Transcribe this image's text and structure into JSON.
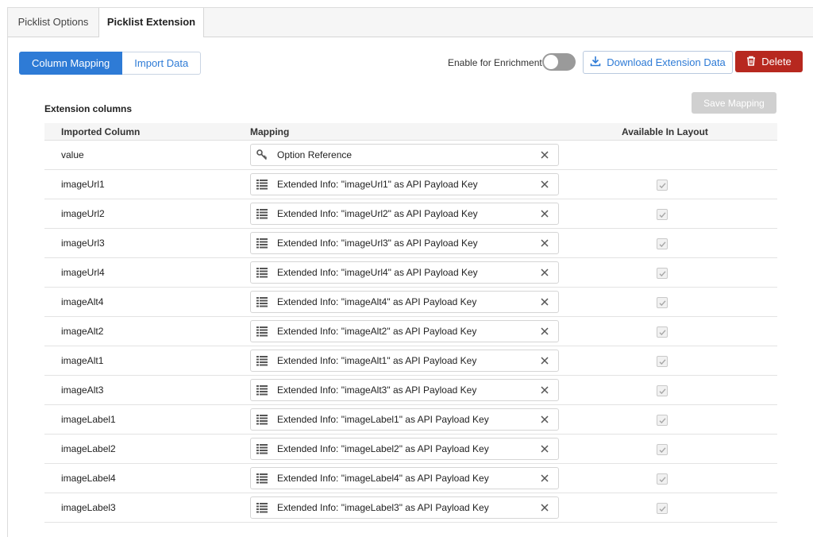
{
  "tabs": [
    {
      "label": "Picklist Options",
      "active": false
    },
    {
      "label": "Picklist Extension",
      "active": true
    }
  ],
  "segment": {
    "column_mapping": "Column Mapping",
    "import_data": "Import Data"
  },
  "toolbar": {
    "enrichment_label": "Enable for Enrichment",
    "enrichment_enabled": false,
    "download_label": "Download Extension Data",
    "delete_label": "Delete"
  },
  "section": {
    "title": "Extension columns",
    "save_label": "Save Mapping"
  },
  "table": {
    "headers": {
      "imported": "Imported Column",
      "mapping": "Mapping",
      "available": "Available In Layout"
    },
    "rows": [
      {
        "name": "value",
        "mapping": "Option Reference",
        "icon": "key-icon",
        "available": null
      },
      {
        "name": "imageUrl1",
        "mapping": "Extended Info: \"imageUrl1\" as API Payload Key",
        "icon": "table-list-icon",
        "available": true
      },
      {
        "name": "imageUrl2",
        "mapping": "Extended Info: \"imageUrl2\" as API Payload Key",
        "icon": "table-list-icon",
        "available": true
      },
      {
        "name": "imageUrl3",
        "mapping": "Extended Info: \"imageUrl3\" as API Payload Key",
        "icon": "table-list-icon",
        "available": true
      },
      {
        "name": "imageUrl4",
        "mapping": "Extended Info: \"imageUrl4\" as API Payload Key",
        "icon": "table-list-icon",
        "available": true
      },
      {
        "name": "imageAlt4",
        "mapping": "Extended Info: \"imageAlt4\" as API Payload Key",
        "icon": "table-list-icon",
        "available": true
      },
      {
        "name": "imageAlt2",
        "mapping": "Extended Info: \"imageAlt2\" as API Payload Key",
        "icon": "table-list-icon",
        "available": true
      },
      {
        "name": "imageAlt1",
        "mapping": "Extended Info: \"imageAlt1\" as API Payload Key",
        "icon": "table-list-icon",
        "available": true
      },
      {
        "name": "imageAlt3",
        "mapping": "Extended Info: \"imageAlt3\" as API Payload Key",
        "icon": "table-list-icon",
        "available": true
      },
      {
        "name": "imageLabel1",
        "mapping": "Extended Info: \"imageLabel1\" as API Payload Key",
        "icon": "table-list-icon",
        "available": true
      },
      {
        "name": "imageLabel2",
        "mapping": "Extended Info: \"imageLabel2\" as API Payload Key",
        "icon": "table-list-icon",
        "available": true
      },
      {
        "name": "imageLabel4",
        "mapping": "Extended Info: \"imageLabel4\" as API Payload Key",
        "icon": "table-list-icon",
        "available": true
      },
      {
        "name": "imageLabel3",
        "mapping": "Extended Info: \"imageLabel3\" as API Payload Key",
        "icon": "table-list-icon",
        "available": true
      }
    ]
  },
  "colors": {
    "primary": "#2e7bd6",
    "danger": "#b7281f",
    "disabled": "#d0d0d0",
    "toggle_off": "#9a9a9a"
  }
}
